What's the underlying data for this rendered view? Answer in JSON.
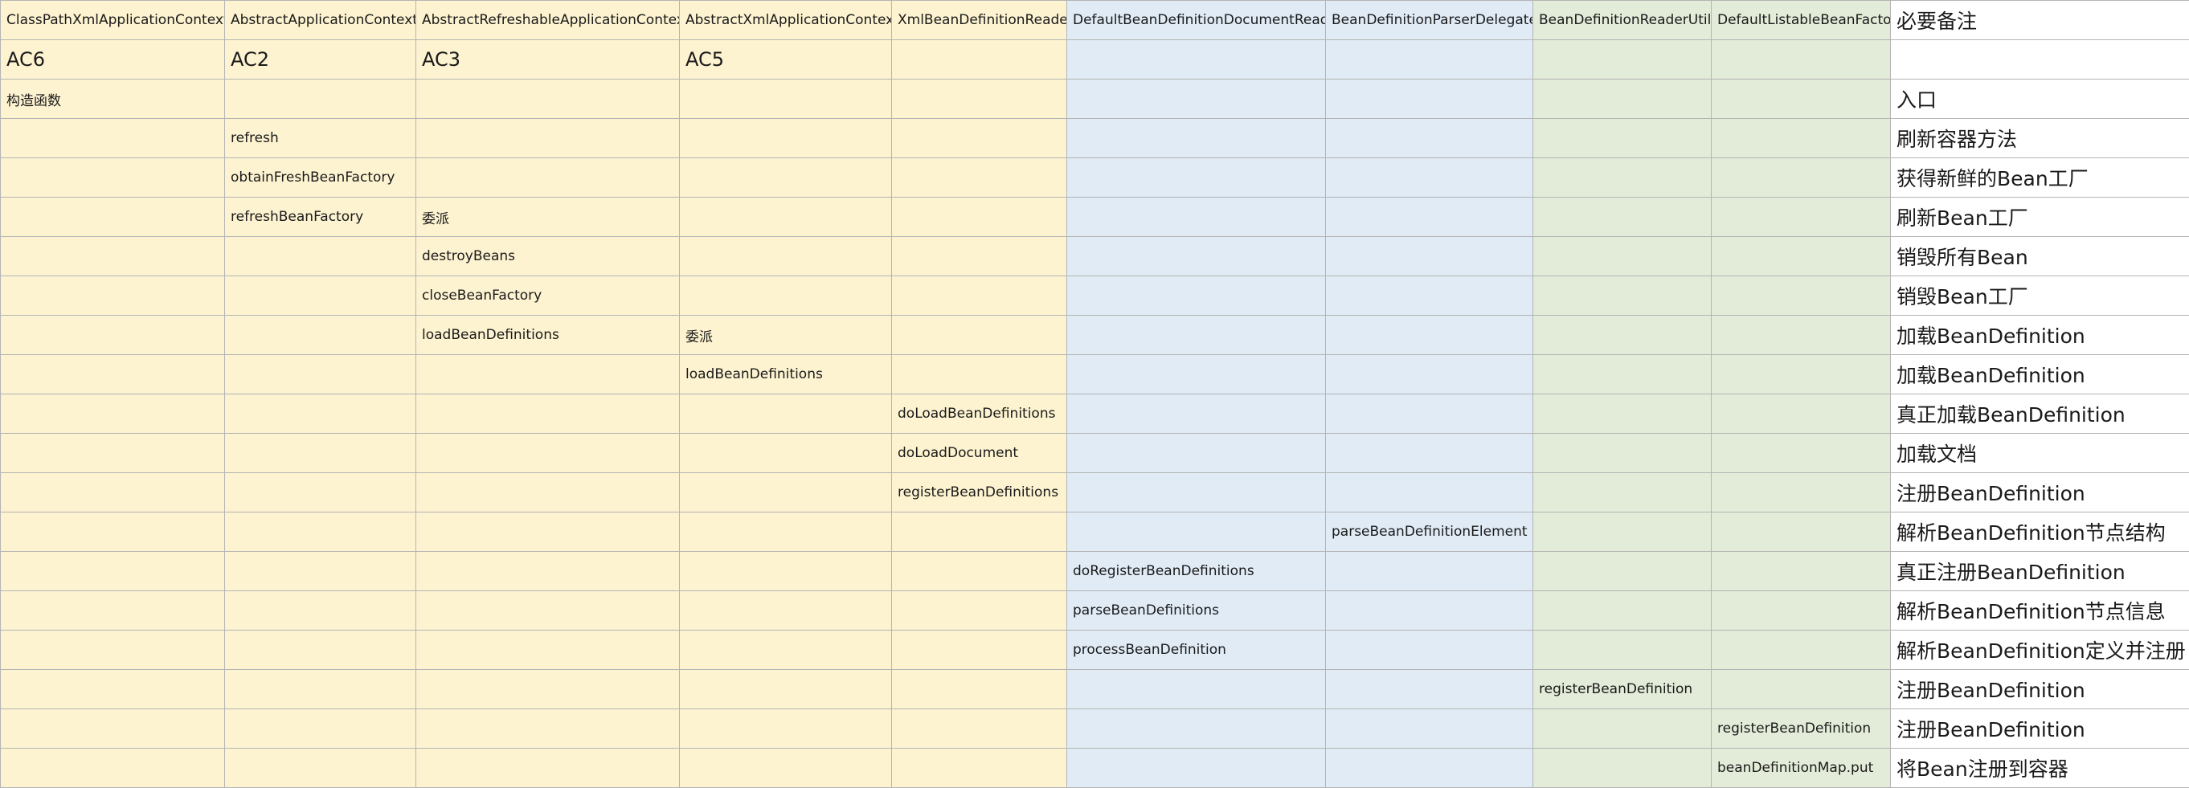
{
  "sheet": {
    "columns": [
      {
        "key": "c1",
        "color": "yellow"
      },
      {
        "key": "c2",
        "color": "yellow"
      },
      {
        "key": "c3",
        "color": "yellow"
      },
      {
        "key": "c4",
        "color": "yellow"
      },
      {
        "key": "c5",
        "color": "yellow"
      },
      {
        "key": "c6",
        "color": "blue"
      },
      {
        "key": "c7",
        "color": "blue"
      },
      {
        "key": "c8",
        "color": "green"
      },
      {
        "key": "c9",
        "color": "green"
      },
      {
        "key": "c10",
        "color": "white"
      }
    ],
    "rows": [
      [
        "ClassPathXmlApplicationContext",
        "AbstractApplicationContext",
        "AbstractRefreshableApplicationContext",
        "AbstractXmlApplicationContext",
        "XmlBeanDefinitionReader",
        "DefaultBeanDefinitionDocumentReader",
        "BeanDefinitionParserDelegate",
        "BeanDefinitionReaderUtils",
        "DefaultListableBeanFactory",
        "必要备注"
      ],
      [
        "AC6",
        "AC2",
        "AC3",
        "AC5",
        "",
        "",
        "",
        "",
        "",
        ""
      ],
      [
        "构造函数",
        "",
        "",
        "",
        "",
        "",
        "",
        "",
        "",
        "入口"
      ],
      [
        "",
        "refresh",
        "",
        "",
        "",
        "",
        "",
        "",
        "",
        "刷新容器方法"
      ],
      [
        "",
        "obtainFreshBeanFactory",
        "",
        "",
        "",
        "",
        "",
        "",
        "",
        "获得新鲜的Bean工厂"
      ],
      [
        "",
        "refreshBeanFactory",
        "委派",
        "",
        "",
        "",
        "",
        "",
        "",
        "刷新Bean工厂"
      ],
      [
        "",
        "",
        "destroyBeans",
        "",
        "",
        "",
        "",
        "",
        "",
        "销毁所有Bean"
      ],
      [
        "",
        "",
        "closeBeanFactory",
        "",
        "",
        "",
        "",
        "",
        "",
        "销毁Bean工厂"
      ],
      [
        "",
        "",
        "loadBeanDefinitions",
        "委派",
        "",
        "",
        "",
        "",
        "",
        "加载BeanDefinition"
      ],
      [
        "",
        "",
        "",
        "loadBeanDefinitions",
        "",
        "",
        "",
        "",
        "",
        "加载BeanDefinition"
      ],
      [
        "",
        "",
        "",
        "",
        "doLoadBeanDefinitions",
        "",
        "",
        "",
        "",
        "真正加载BeanDefinition"
      ],
      [
        "",
        "",
        "",
        "",
        "doLoadDocument",
        "",
        "",
        "",
        "",
        "加载文档"
      ],
      [
        "",
        "",
        "",
        "",
        "registerBeanDefinitions",
        "",
        "",
        "",
        "",
        "注册BeanDefinition"
      ],
      [
        "",
        "",
        "",
        "",
        "",
        "",
        "parseBeanDefinitionElement",
        "",
        "",
        "解析BeanDefinition节点结构"
      ],
      [
        "",
        "",
        "",
        "",
        "",
        "doRegisterBeanDefinitions",
        "",
        "",
        "",
        "真正注册BeanDefinition"
      ],
      [
        "",
        "",
        "",
        "",
        "",
        "parseBeanDefinitions",
        "",
        "",
        "",
        "解析BeanDefinition节点信息"
      ],
      [
        "",
        "",
        "",
        "",
        "",
        "processBeanDefinition",
        "",
        "",
        "",
        "解析BeanDefinition定义并注册"
      ],
      [
        "",
        "",
        "",
        "",
        "",
        "",
        "",
        "registerBeanDefinition",
        "",
        "注册BeanDefinition"
      ],
      [
        "",
        "",
        "",
        "",
        "",
        "",
        "",
        "",
        "registerBeanDefinition",
        "注册BeanDefinition"
      ],
      [
        "",
        "",
        "",
        "",
        "",
        "",
        "",
        "",
        "beanDefinitionMap.put",
        "将Bean注册到容器"
      ]
    ]
  }
}
